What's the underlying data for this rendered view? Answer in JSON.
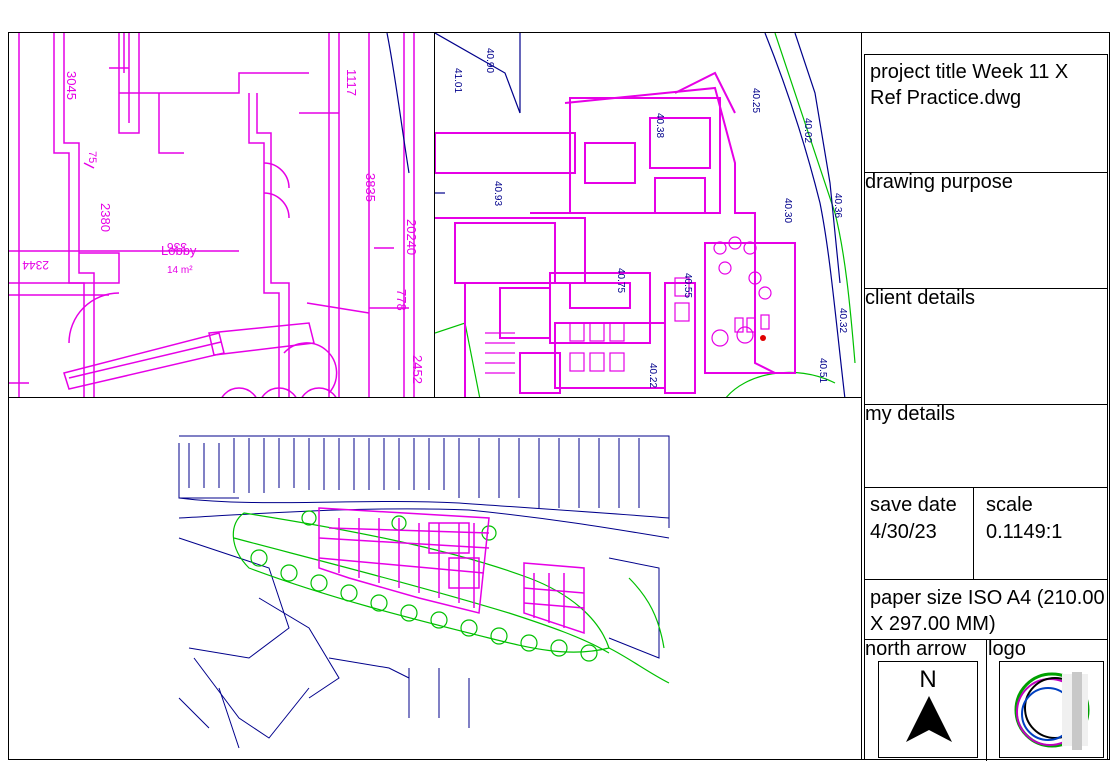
{
  "title_block": {
    "project_title": "project title Week 11 X Ref Practice.dwg",
    "drawing_purpose": "drawing purpose",
    "client_details": "client details",
    "my_details": "my details",
    "save_date_label": "save date",
    "save_date_value": "4/30/23",
    "scale_label": "scale",
    "scale_value": "0.1149:1",
    "paper_size": "paper size ISO A4 (210.00 X 297.00 MM)",
    "north_arrow_label": "north arrow",
    "north_letter": "N",
    "logo_label": "logo"
  },
  "plan_detail": {
    "dims": [
      "3045",
      "2380",
      "3835",
      "20240",
      "778",
      "2452",
      "1117",
      "75",
      "2344"
    ],
    "room_label": "Lobby",
    "room_area": "14 m²",
    "room_number": "336"
  },
  "plan_overview": {
    "levels": [
      "40.90",
      "41.01",
      "40.93",
      "40.75",
      "40.55",
      "40.30",
      "40.02",
      "40.32",
      "40.51",
      "40.25",
      "40.22",
      "40.36",
      "40.38"
    ]
  },
  "colors": {
    "walls": "#e600e6",
    "survey": "#00008b",
    "green": "#00c000"
  }
}
